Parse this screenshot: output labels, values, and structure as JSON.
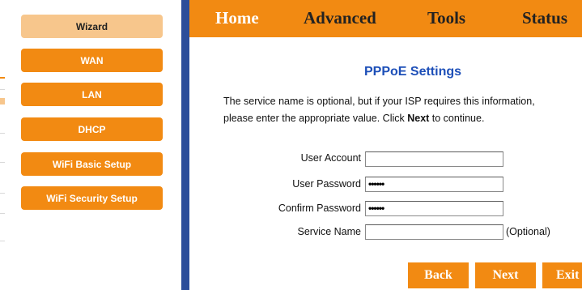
{
  "sidebar": {
    "items": [
      {
        "label": "Wizard",
        "active": true
      },
      {
        "label": "WAN"
      },
      {
        "label": "LAN"
      },
      {
        "label": "DHCP"
      },
      {
        "label": "WiFi Basic Setup"
      },
      {
        "label": "WiFi Security Setup"
      }
    ]
  },
  "nav": {
    "tabs": [
      {
        "label": "Home"
      },
      {
        "label": "Advanced"
      },
      {
        "label": "Tools"
      },
      {
        "label": "Status"
      }
    ]
  },
  "content": {
    "title": "PPPoE Settings",
    "description_pre": "The service name is optional, but if your ISP requires this information, please enter the appropriate value. Click ",
    "description_bold": "Next",
    "description_post": " to continue.",
    "form": {
      "user_account_label": "User Account",
      "user_account_value": "",
      "user_password_label": "User Password",
      "user_password_value": "••••••",
      "confirm_password_label": "Confirm Password",
      "confirm_password_value": "••••••",
      "service_name_label": "Service Name",
      "service_name_value": "",
      "optional_label": "(Optional)"
    },
    "buttons": {
      "back": "Back",
      "next": "Next",
      "exit": "Exit"
    }
  },
  "colors": {
    "accent": "#f28a12",
    "active_sidebar": "#f7c68c",
    "divider": "#2c4d9a",
    "title": "#1d4fb8"
  }
}
